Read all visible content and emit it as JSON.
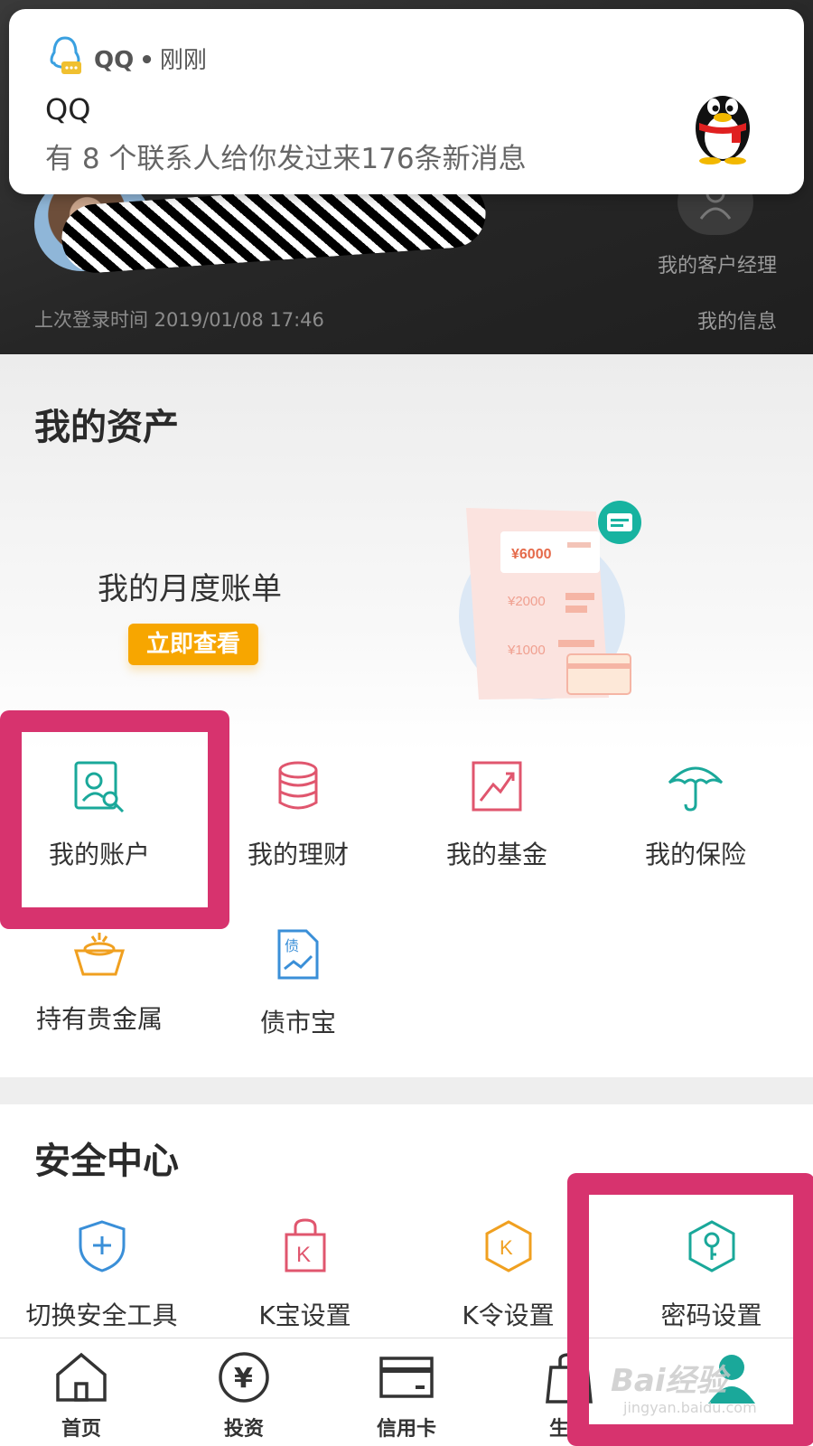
{
  "notification": {
    "app_name": "QQ",
    "separator": "•",
    "time": "刚刚",
    "title": "QQ",
    "message": "有 8 个联系人给你发过来176条新消息"
  },
  "profile": {
    "manager_label": "我的客户经理",
    "last_login": "上次登录时间 2019/01/08 17:46",
    "my_info": "我的信息"
  },
  "assets": {
    "title": "我的资产",
    "monthly_bill": {
      "title": "我的月度账单",
      "button": "立即查看",
      "amounts": [
        "¥6000",
        "¥2000",
        "¥1000"
      ]
    },
    "items": [
      {
        "label": "我的账户",
        "icon": "account-search-icon",
        "color": "#1aa89a"
      },
      {
        "label": "我的理财",
        "icon": "coin-stack-icon",
        "color": "#e0566e"
      },
      {
        "label": "我的基金",
        "icon": "trend-chart-icon",
        "color": "#e0566e"
      },
      {
        "label": "我的保险",
        "icon": "umbrella-icon",
        "color": "#1aa89a"
      },
      {
        "label": "持有贵金属",
        "icon": "gold-basket-icon",
        "color": "#f0a020"
      },
      {
        "label": "债市宝",
        "icon": "bond-document-icon",
        "color": "#3a8fd8",
        "glyph": "债"
      }
    ]
  },
  "security": {
    "title": "安全中心",
    "items": [
      {
        "label": "切换安全工具",
        "icon": "shield-plus-icon",
        "color": "#3a8fd8"
      },
      {
        "label": "K宝设置",
        "icon": "k-lock-icon",
        "color": "#e0566e",
        "glyph": "K"
      },
      {
        "label": "K令设置",
        "icon": "k-hexagon-icon",
        "color": "#f0a020",
        "glyph": "K"
      },
      {
        "label": "密码设置",
        "icon": "key-hexagon-icon",
        "color": "#1aa89a"
      }
    ]
  },
  "bottom_nav": {
    "items": [
      {
        "label": "首页",
        "icon": "home-icon"
      },
      {
        "label": "投资",
        "icon": "yuan-icon",
        "glyph": "¥"
      },
      {
        "label": "信用卡",
        "icon": "credit-card-icon"
      },
      {
        "label": "生活",
        "icon": "shopping-bag-icon"
      },
      {
        "label": "",
        "icon": "user-icon",
        "color": "#1aa89a"
      }
    ]
  },
  "watermark": {
    "text": "Bai经验",
    "url": "jingyan.baidu.com"
  },
  "colors": {
    "highlight": "#d7336e",
    "accent_orange": "#f7a600",
    "teal": "#1aa89a"
  }
}
